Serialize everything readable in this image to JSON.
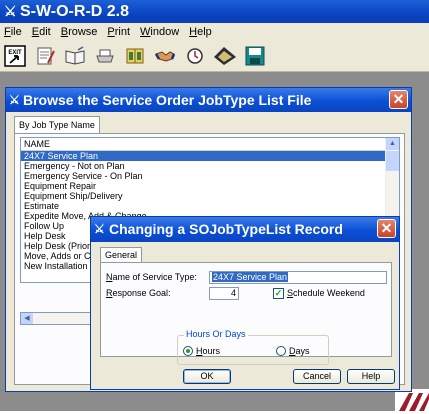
{
  "app": {
    "title": "S-W-O-R-D 2.8",
    "menu": [
      "File",
      "Edit",
      "Browse",
      "Print",
      "Window",
      "Help"
    ],
    "toolbar_icons": [
      "exit-icon",
      "notepad-icon",
      "book-icon",
      "printer-icon",
      "binoculars-icon",
      "handshake-icon",
      "clock-icon",
      "pen-icon",
      "save-icon"
    ],
    "toolbar_exit_label": "EXIT"
  },
  "browse": {
    "title": "Browse the Service Order JobType List File",
    "tab": "By Job Type Name",
    "column_header": "NAME",
    "rows": [
      "24X7 Service Plan",
      "Emergency - Not on Plan",
      "Emergency Service - On Plan",
      "Equipment Repair",
      "Equipment Ship/Delivery",
      "Estimate",
      "Expedite Move, Add & Change",
      "Follow Up",
      "Help Desk",
      "Help Desk (Priority)",
      "Move, Adds or Chan",
      "New Installation"
    ],
    "selected_index": 0
  },
  "dialog": {
    "title": "Changing a SOJobTypeList Record",
    "tab": "General",
    "name_label": "Name of Service Type:",
    "name_value": "24X7 Service Plan",
    "response_label": "Response Goal:",
    "response_value": "4",
    "schedule_weekend_label": "Schedule Weekend",
    "schedule_weekend_checked": true,
    "group_title": "Hours Or Days",
    "hours_label": "Hours",
    "days_label": "Days",
    "selected_unit": "Hours",
    "ok_label": "OK",
    "cancel_label": "Cancel",
    "help_label": "Help"
  },
  "colors": {
    "titlebar": "#0b4fd6",
    "selection": "#316ac5",
    "workspace": "#8c8c8c",
    "dialog_face": "#ece9d8"
  }
}
